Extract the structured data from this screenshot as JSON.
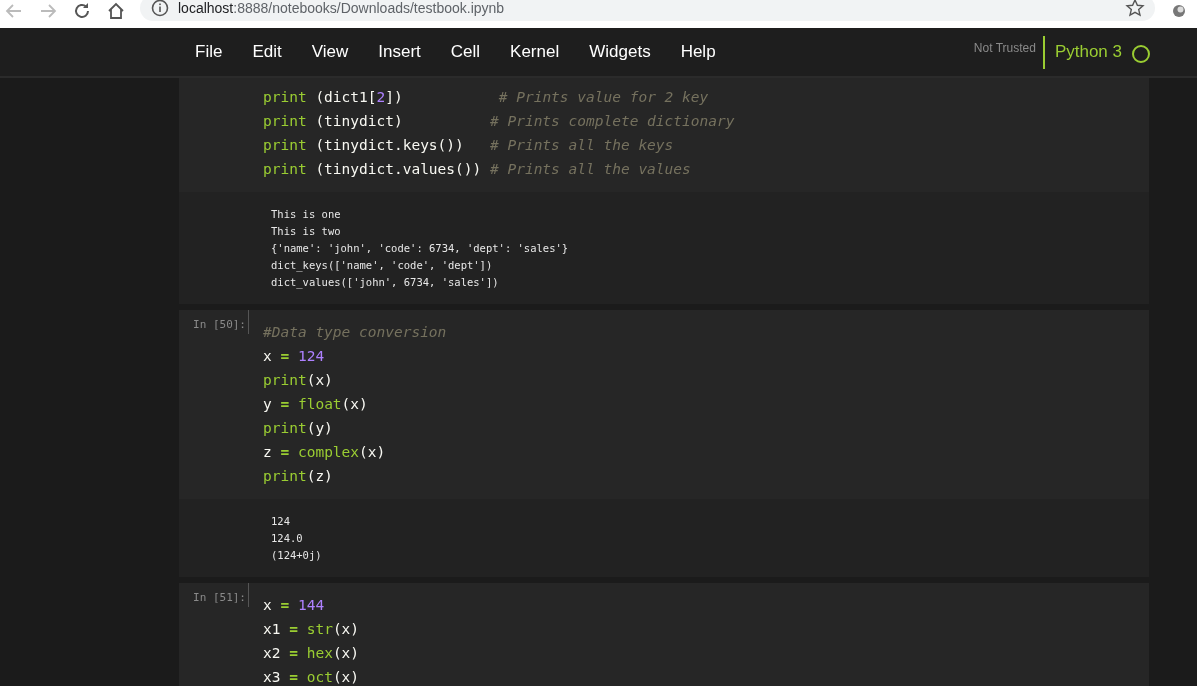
{
  "browser": {
    "address": {
      "host": "localhost",
      "path": ":8888/notebooks/Downloads/testbook.ipynb"
    }
  },
  "menu": [
    "File",
    "Edit",
    "View",
    "Insert",
    "Cell",
    "Kernel",
    "Widgets",
    "Help"
  ],
  "kernel": {
    "trusted": "Not Trusted",
    "name": "Python 3",
    "busy": false
  },
  "cells": [
    {
      "code": [
        [
          {
            "kind": "builtin",
            "text": "print"
          },
          {
            "kind": "plain",
            "text": " (dict1["
          },
          {
            "kind": "num",
            "text": "2"
          },
          {
            "kind": "plain",
            "text": "])           "
          },
          {
            "kind": "comment",
            "text": "# Prints value for 2 key"
          }
        ],
        [
          {
            "kind": "builtin",
            "text": "print"
          },
          {
            "kind": "plain",
            "text": " (tinydict)          "
          },
          {
            "kind": "comment",
            "text": "# Prints complete dictionary"
          }
        ],
        [
          {
            "kind": "builtin",
            "text": "print"
          },
          {
            "kind": "plain",
            "text": " (tinydict.keys())   "
          },
          {
            "kind": "comment",
            "text": "# Prints all the keys"
          }
        ],
        [
          {
            "kind": "builtin",
            "text": "print"
          },
          {
            "kind": "plain",
            "text": " (tinydict.values()) "
          },
          {
            "kind": "comment",
            "text": "# Prints all the values"
          }
        ]
      ],
      "output": [
        "This is one",
        "This is two",
        "{'name': 'john', 'code': 6734, 'dept': 'sales'}",
        "dict_keys(['name', 'code', 'dept'])",
        "dict_values(['john', 6734, 'sales'])"
      ]
    },
    {
      "prompt": "In [50]:",
      "code": [
        [
          {
            "kind": "comment",
            "text": "#Data type conversion"
          }
        ],
        [
          {
            "kind": "plain",
            "text": "x "
          },
          {
            "kind": "op",
            "text": "= "
          },
          {
            "kind": "num",
            "text": "124"
          }
        ],
        [
          {
            "kind": "builtin",
            "text": "print"
          },
          {
            "kind": "plain",
            "text": "(x)"
          }
        ],
        [
          {
            "kind": "plain",
            "text": "y "
          },
          {
            "kind": "op",
            "text": "= "
          },
          {
            "kind": "builtin",
            "text": "float"
          },
          {
            "kind": "plain",
            "text": "(x)"
          }
        ],
        [
          {
            "kind": "builtin",
            "text": "print"
          },
          {
            "kind": "plain",
            "text": "(y)"
          }
        ],
        [
          {
            "kind": "plain",
            "text": "z "
          },
          {
            "kind": "op",
            "text": "= "
          },
          {
            "kind": "builtin",
            "text": "complex"
          },
          {
            "kind": "plain",
            "text": "(x)"
          }
        ],
        [
          {
            "kind": "builtin",
            "text": "print"
          },
          {
            "kind": "plain",
            "text": "(z)"
          }
        ]
      ],
      "output": [
        "124",
        "124.0",
        "(124+0j)"
      ]
    },
    {
      "prompt": "In [51]:",
      "code": [
        [
          {
            "kind": "plain",
            "text": "x "
          },
          {
            "kind": "op",
            "text": "= "
          },
          {
            "kind": "num",
            "text": "144"
          }
        ],
        [
          {
            "kind": "plain",
            "text": "x1 "
          },
          {
            "kind": "op",
            "text": "= "
          },
          {
            "kind": "builtin",
            "text": "str"
          },
          {
            "kind": "plain",
            "text": "(x)"
          }
        ],
        [
          {
            "kind": "plain",
            "text": "x2 "
          },
          {
            "kind": "op",
            "text": "= "
          },
          {
            "kind": "builtin",
            "text": "hex"
          },
          {
            "kind": "plain",
            "text": "(x)"
          }
        ],
        [
          {
            "kind": "plain",
            "text": "x3 "
          },
          {
            "kind": "op",
            "text": "= "
          },
          {
            "kind": "builtin",
            "text": "oct"
          },
          {
            "kind": "plain",
            "text": "(x)"
          }
        ]
      ]
    }
  ]
}
